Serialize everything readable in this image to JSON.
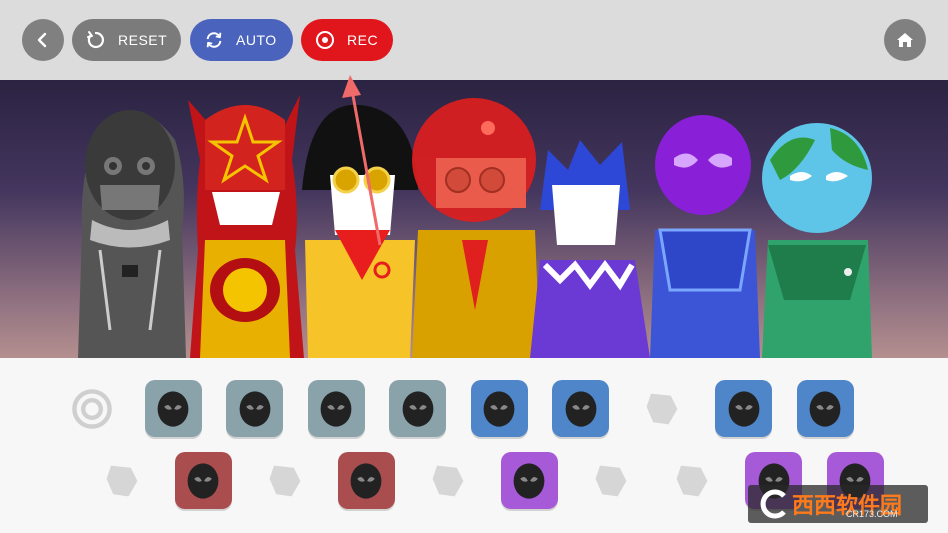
{
  "toolbar": {
    "back": {
      "icon": "chevron-left-icon"
    },
    "reset": {
      "label": "RESET",
      "icon": "reset-icon"
    },
    "auto": {
      "label": "AUTO",
      "icon": "refresh-icon"
    },
    "rec": {
      "label": "REC",
      "icon": "record-icon"
    },
    "home": {
      "icon": "home-icon"
    }
  },
  "colors": {
    "toolbar_bg": "#dcdcdc",
    "grey_button": "#7b7b7b",
    "auto_button": "#4a63bd",
    "rec_button": "#e0161c",
    "annotation_arrow": "#f06a6a"
  },
  "characters": [
    {
      "name": "grey-hooded-character"
    },
    {
      "name": "red-star-character"
    },
    {
      "name": "yellow-goggles-character"
    },
    {
      "name": "red-helmet-character"
    },
    {
      "name": "blue-cat-character"
    },
    {
      "name": "purple-alien-character"
    },
    {
      "name": "earth-head-character"
    }
  ],
  "sound_icons": {
    "row1": [
      {
        "name": "target-sound-icon",
        "active": false,
        "color": "#d6d6d6"
      },
      {
        "name": "alien-head-sound-icon",
        "active": true,
        "color": "#8aa3aa"
      },
      {
        "name": "alien-face-sound-icon",
        "active": true,
        "color": "#8aa3aa"
      },
      {
        "name": "mask-sound-icon",
        "active": true,
        "color": "#8aa3aa"
      },
      {
        "name": "horned-helmet-sound-icon",
        "active": true,
        "color": "#8aa3aa"
      },
      {
        "name": "crab-sound-icon",
        "active": true,
        "color": "#4f86c9"
      },
      {
        "name": "crystal-sound-icon",
        "active": true,
        "color": "#4f86c9"
      },
      {
        "name": "map-sound-icon",
        "active": false,
        "color": "#d6d6d6"
      },
      {
        "name": "speaker-sound-icon",
        "active": true,
        "color": "#4f86c9"
      },
      {
        "name": "number-box-sound-icon",
        "active": true,
        "color": "#4f86c9"
      }
    ],
    "row2": [
      {
        "name": "star-badge-sound-icon",
        "active": false,
        "color": "#d6d6d6"
      },
      {
        "name": "planet-sound-icon",
        "active": true,
        "color": "#a94d4f"
      },
      {
        "name": "glasses-sound-icon",
        "active": false,
        "color": "#d6d6d6"
      },
      {
        "name": "top-hat-sound-icon",
        "active": true,
        "color": "#a94d4f"
      },
      {
        "name": "beard-sound-icon",
        "active": false,
        "color": "#d6d6d6"
      },
      {
        "name": "collar-sound-icon",
        "active": true,
        "color": "#a65ad8"
      },
      {
        "name": "broken-shape-sound-icon",
        "active": false,
        "color": "#d6d6d6"
      },
      {
        "name": "fan-sound-icon",
        "active": false,
        "color": "#d6d6d6"
      },
      {
        "name": "disc-sound-icon",
        "active": true,
        "color": "#a65ad8"
      },
      {
        "name": "brim-sound-icon",
        "active": true,
        "color": "#a65ad8"
      }
    ]
  },
  "watermark": {
    "brand": "西西软件园",
    "url": "CR173.COM",
    "logo_letter": "C"
  }
}
